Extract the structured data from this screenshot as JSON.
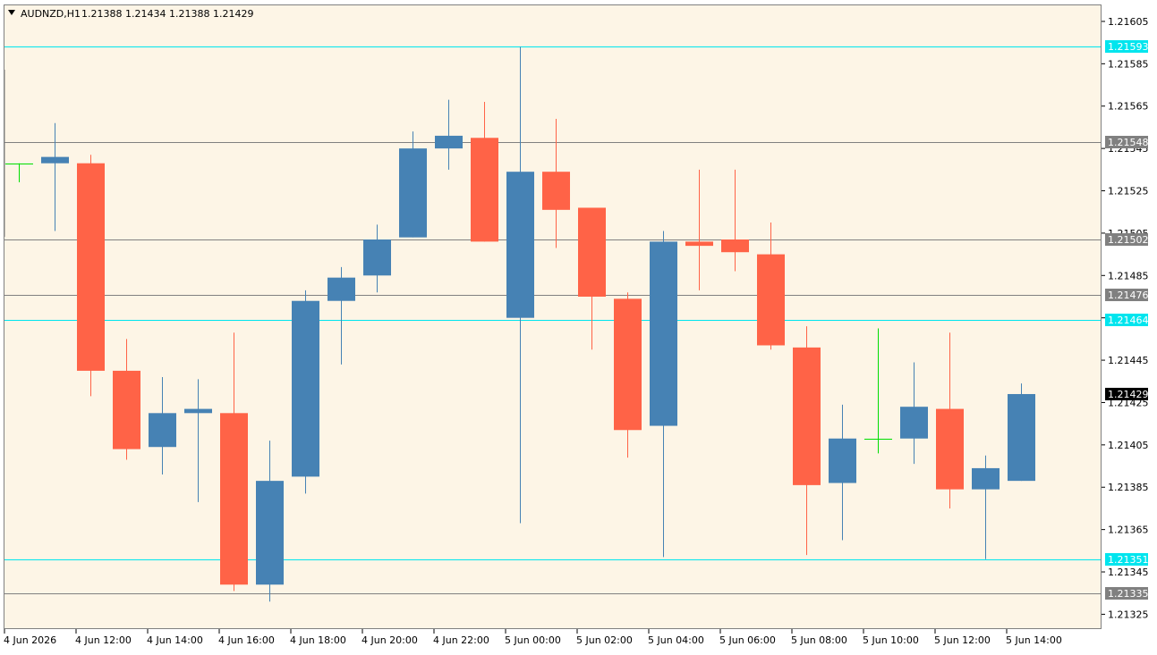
{
  "title": {
    "symbol": "AUDNZD,H1",
    "ohlc": "1.21388 1.21434 1.21388 1.21429",
    "menu_icon": "triangle-down-icon"
  },
  "colors": {
    "background": "#fdf5e6",
    "bull_candle": "#4682b4",
    "bear_candle": "#ff6347",
    "doji_candle": "#00dd00",
    "cyan_line": "#00e5ee",
    "gray_line": "#808080",
    "current_price_bg": "#000000"
  },
  "chart_data": {
    "type": "candlestick",
    "price_range": [
      1.21318,
      1.21613
    ],
    "y_ticks": [
      "1.21605",
      "1.21585",
      "1.21565",
      "1.21545",
      "1.21525",
      "1.21505",
      "1.21485",
      "1.21465",
      "1.21445",
      "1.21425",
      "1.21405",
      "1.21385",
      "1.21365",
      "1.21345",
      "1.21325"
    ],
    "x_labels": [
      "4 Jun 2026",
      "4 Jun 12:00",
      "4 Jun 14:00",
      "4 Jun 16:00",
      "4 Jun 18:00",
      "4 Jun 20:00",
      "4 Jun 22:00",
      "5 Jun 00:00",
      "5 Jun 02:00",
      "5 Jun 04:00",
      "5 Jun 06:00",
      "5 Jun 08:00",
      "5 Jun 10:00",
      "5 Jun 12:00",
      "5 Jun 14:00"
    ],
    "candles": [
      {
        "o": 1.21538,
        "h": 1.21538,
        "l": 1.21529,
        "c": 1.21538
      },
      {
        "o": 1.21538,
        "h": 1.21557,
        "l": 1.21506,
        "c": 1.21541
      },
      {
        "o": 1.21538,
        "h": 1.21542,
        "l": 1.21428,
        "c": 1.2144
      },
      {
        "o": 1.2144,
        "h": 1.21455,
        "l": 1.21398,
        "c": 1.21403
      },
      {
        "o": 1.21404,
        "h": 1.21437,
        "l": 1.21391,
        "c": 1.2142
      },
      {
        "o": 1.2142,
        "h": 1.21436,
        "l": 1.21378,
        "c": 1.21422
      },
      {
        "o": 1.2142,
        "h": 1.21458,
        "l": 1.21336,
        "c": 1.21339
      },
      {
        "o": 1.21339,
        "h": 1.21407,
        "l": 1.21331,
        "c": 1.21388
      },
      {
        "o": 1.2139,
        "h": 1.21478,
        "l": 1.21382,
        "c": 1.21473
      },
      {
        "o": 1.21473,
        "h": 1.21489,
        "l": 1.21443,
        "c": 1.21484
      },
      {
        "o": 1.21485,
        "h": 1.21509,
        "l": 1.21477,
        "c": 1.21502
      },
      {
        "o": 1.21503,
        "h": 1.21553,
        "l": 1.21503,
        "c": 1.21545
      },
      {
        "o": 1.21545,
        "h": 1.21568,
        "l": 1.21535,
        "c": 1.21551
      },
      {
        "o": 1.2155,
        "h": 1.21567,
        "l": 1.21501,
        "c": 1.21501
      },
      {
        "o": 1.21465,
        "h": 1.21593,
        "l": 1.21368,
        "c": 1.21534
      },
      {
        "o": 1.21534,
        "h": 1.21559,
        "l": 1.21498,
        "c": 1.21516
      },
      {
        "o": 1.21517,
        "h": 1.21517,
        "l": 1.2145,
        "c": 1.21475
      },
      {
        "o": 1.21474,
        "h": 1.21477,
        "l": 1.21399,
        "c": 1.21412
      },
      {
        "o": 1.21414,
        "h": 1.21506,
        "l": 1.21352,
        "c": 1.21501
      },
      {
        "o": 1.21501,
        "h": 1.21535,
        "l": 1.21478,
        "c": 1.21499
      },
      {
        "o": 1.21502,
        "h": 1.21535,
        "l": 1.21487,
        "c": 1.21496
      },
      {
        "o": 1.21495,
        "h": 1.2151,
        "l": 1.2145,
        "c": 1.21452
      },
      {
        "o": 1.21451,
        "h": 1.21461,
        "l": 1.21353,
        "c": 1.21386
      },
      {
        "o": 1.21387,
        "h": 1.21424,
        "l": 1.2136,
        "c": 1.21408
      },
      {
        "o": 1.21408,
        "h": 1.2146,
        "l": 1.21401,
        "c": 1.21408
      },
      {
        "o": 1.21408,
        "h": 1.21444,
        "l": 1.21396,
        "c": 1.21423
      },
      {
        "o": 1.21422,
        "h": 1.21458,
        "l": 1.21375,
        "c": 1.21384
      },
      {
        "o": 1.21384,
        "h": 1.214,
        "l": 1.21351,
        "c": 1.21394
      },
      {
        "o": 1.21388,
        "h": 1.21434,
        "l": 1.21388,
        "c": 1.21429
      }
    ],
    "levels": [
      {
        "price": 1.21593,
        "label": "1.21593",
        "kind": "cyan"
      },
      {
        "price": 1.21548,
        "label": "1.21548",
        "kind": "gray"
      },
      {
        "price": 1.21502,
        "label": "1.21502",
        "kind": "gray"
      },
      {
        "price": 1.21476,
        "label": "1.21476",
        "kind": "gray"
      },
      {
        "price": 1.21464,
        "label": "1.21464",
        "kind": "cyan"
      },
      {
        "price": 1.21351,
        "label": "1.21351",
        "kind": "cyan"
      },
      {
        "price": 1.21335,
        "label": "1.21335",
        "kind": "gray"
      }
    ],
    "current_price": {
      "price": 1.21429,
      "label": "1.21429"
    }
  }
}
